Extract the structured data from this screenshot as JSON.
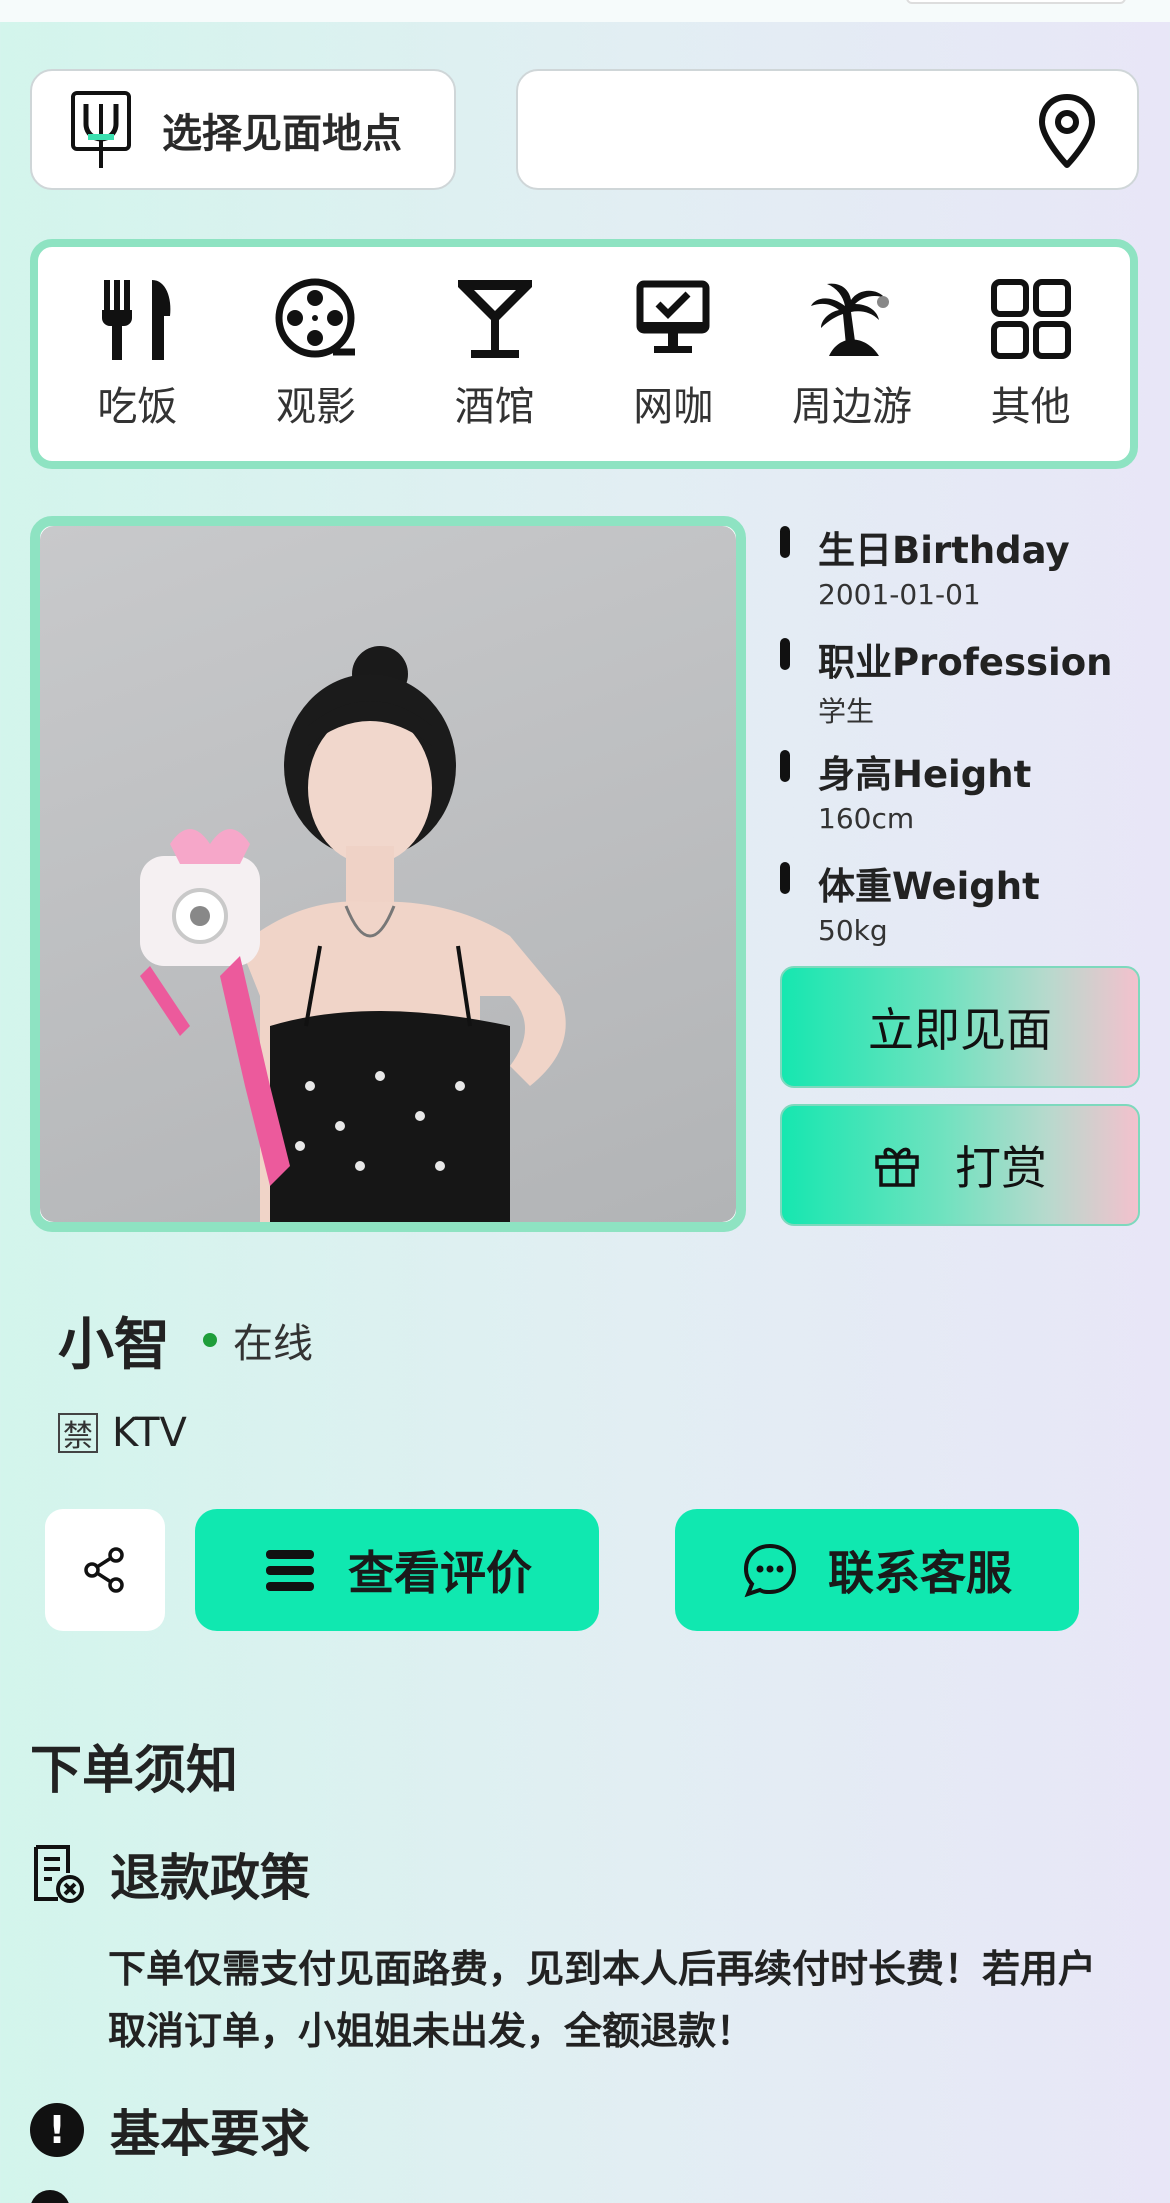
{
  "location": {
    "button_label": "选择见面地点",
    "address_value": ""
  },
  "categories": [
    {
      "label": "吃饭",
      "icon": "utensils-icon"
    },
    {
      "label": "观影",
      "icon": "film-reel-icon"
    },
    {
      "label": "酒馆",
      "icon": "cocktail-icon"
    },
    {
      "label": "网咖",
      "icon": "monitor-check-icon"
    },
    {
      "label": "周边游",
      "icon": "palm-island-icon"
    },
    {
      "label": "其他",
      "icon": "grid-icon"
    }
  ],
  "profile": {
    "name": "小智",
    "status": "在线",
    "tag_badge": "禁",
    "tag_text": "KTV",
    "info": [
      {
        "key": "生日Birthday",
        "value": "2001-01-01"
      },
      {
        "key": "职业Profession",
        "value": "学生"
      },
      {
        "key": "身高Height",
        "value": "160cm"
      },
      {
        "key": "体重Weight",
        "value": "50kg"
      }
    ]
  },
  "actions": {
    "meet": "立即见面",
    "tip": "打赏",
    "reviews": "查看评价",
    "service": "联系客服"
  },
  "notice": {
    "title": "下单须知",
    "refund_title": "退款政策",
    "refund_body": "下单仅需支付见面路费，见到本人后再续付时长费！若用户取消订单，小姐姐未出发，全额退款！",
    "requirements_title": "基本要求",
    "requirements_icon_glyph": "!"
  },
  "colors": {
    "accent_green": "#10e8b0",
    "frame_green": "#8ee3c2",
    "online_dot": "#1e9e3a"
  }
}
